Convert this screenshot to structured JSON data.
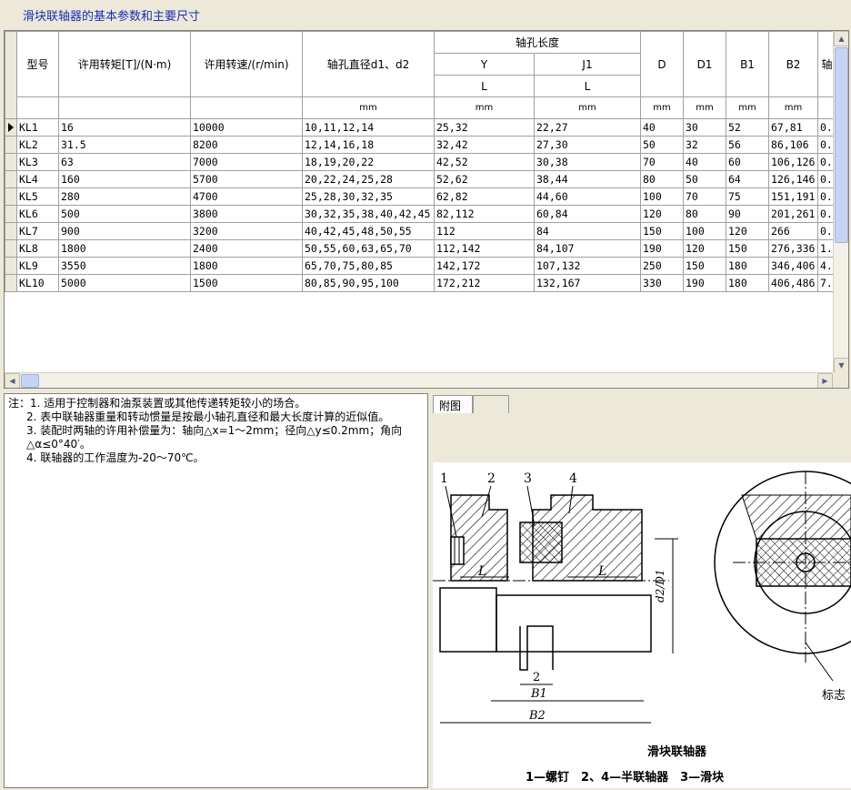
{
  "title": "滑块联轴器的基本参数和主要尺寸",
  "headers": {
    "model": "型号",
    "torque": "许用转矩[T]/(N·m)",
    "speed": "许用转速/(r/min)",
    "bore_dia": "轴孔直径d1、d2",
    "bore_len": "轴孔长度",
    "Y": "Y",
    "J1": "J1",
    "L": "L",
    "D": "D",
    "D1": "D1",
    "B1": "B1",
    "B2": "B2",
    "trunc": "轴",
    "unit": "mm"
  },
  "rows": [
    [
      "KL1",
      "16",
      "10000",
      "10,11,12,14",
      "25,32",
      "22,27",
      "40",
      "30",
      "52",
      "67,81",
      "0."
    ],
    [
      "KL2",
      "31.5",
      "8200",
      "12,14,16,18",
      "32,42",
      "27,30",
      "50",
      "32",
      "56",
      "86,106",
      "0."
    ],
    [
      "KL3",
      "63",
      "7000",
      "18,19,20,22",
      "42,52",
      "30,38",
      "70",
      "40",
      "60",
      "106,126",
      "0."
    ],
    [
      "KL4",
      "160",
      "5700",
      "20,22,24,25,28",
      "52,62",
      "38,44",
      "80",
      "50",
      "64",
      "126,146",
      "0."
    ],
    [
      "KL5",
      "280",
      "4700",
      "25,28,30,32,35",
      "62,82",
      "44,60",
      "100",
      "70",
      "75",
      "151,191",
      "0."
    ],
    [
      "KL6",
      "500",
      "3800",
      "30,32,35,38,40,42,45",
      "82,112",
      "60,84",
      "120",
      "80",
      "90",
      "201,261",
      "0."
    ],
    [
      "KL7",
      "900",
      "3200",
      "40,42,45,48,50,55",
      "112",
      "84",
      "150",
      "100",
      "120",
      "266",
      "0."
    ],
    [
      "KL8",
      "1800",
      "2400",
      "50,55,60,63,65,70",
      "112,142",
      "84,107",
      "190",
      "120",
      "150",
      "276,336",
      "1."
    ],
    [
      "KL9",
      "3550",
      "1800",
      "65,70,75,80,85",
      "142,172",
      "107,132",
      "250",
      "150",
      "180",
      "346,406",
      "4."
    ],
    [
      "KL10",
      "5000",
      "1500",
      "80,85,90,95,100",
      "172,212",
      "132,167",
      "330",
      "190",
      "180",
      "406,486",
      "7."
    ]
  ],
  "notes": [
    "注：1. 适用于控制器和油泵装置或其他传递转矩较小的场合。",
    "2. 表中联轴器重量和转动惯量是按最小轴孔直径和最大长度计算的近似值。",
    "3. 装配时两轴的许用补偿量为：轴向△x=1～2mm；径向△y≤0.2mm；角向△α≤0°40′。",
    "4. 联轴器的工作温度为-20～70℃。"
  ],
  "tabs": [
    "附图",
    ""
  ],
  "figure": {
    "labels": [
      "1",
      "2",
      "3",
      "4"
    ],
    "dim_L": "L",
    "dim_d2D1": "d2/D1",
    "dim_B1": "B1",
    "dim_two": "2",
    "dim_B2": "B2",
    "mark": "标志",
    "caption": "滑块联轴器",
    "legend": "1—螺钉　2、4—半联轴器　3—滑块"
  }
}
